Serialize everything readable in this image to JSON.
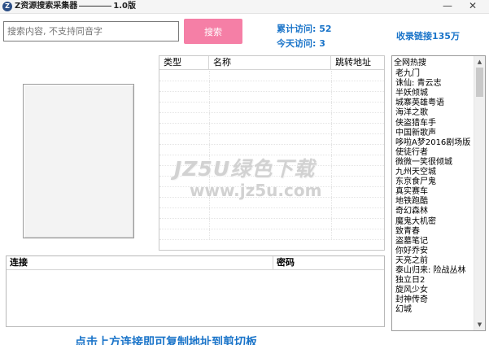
{
  "window": {
    "icon_letter": "Z",
    "title": "Z资源搜索采集器",
    "version": "1.0版",
    "minimize_glyph": "—",
    "close_glyph": "✕"
  },
  "search": {
    "placeholder": "搜索内容, 不支持同音字",
    "button_label": "搜索"
  },
  "stats": {
    "total_visits": "累计访问: 52",
    "today_visits": "今天访问: 3",
    "links_collected": "收录链接135万"
  },
  "results_table": {
    "columns": [
      "类型",
      "名称",
      "跳转地址"
    ]
  },
  "hot_list": {
    "header": "全网热搜",
    "items": [
      "老九门",
      "诛仙: 青云志",
      "半妖倾城",
      "城寨英雄粤语",
      "海洋之歌",
      "侠盗猎车手",
      "中国新歌声",
      "哆啦A梦2016剧场版",
      "使徒行者",
      "微微一笑很倾城",
      "九州天空城",
      "东京食尸鬼",
      "真实赛车",
      "地铁跑酷",
      "奇幻森林",
      "魔鬼大机密",
      "致青春",
      "盗墓笔记",
      "你好乔安",
      "天亮之前",
      "泰山归来: 险战丛林",
      "独立日2",
      "旋风少女",
      "封神传奇",
      "幻城"
    ]
  },
  "connection_table": {
    "columns": [
      "连接",
      "密码"
    ]
  },
  "hint": "点击上方连接即可复制地址到剪切板",
  "watermark": {
    "main": "JZ5U绿色下载",
    "sub": "www.jz5u.com"
  },
  "colors": {
    "accent_blue": "#1a74c9",
    "button_pink": "#f57fa6"
  }
}
